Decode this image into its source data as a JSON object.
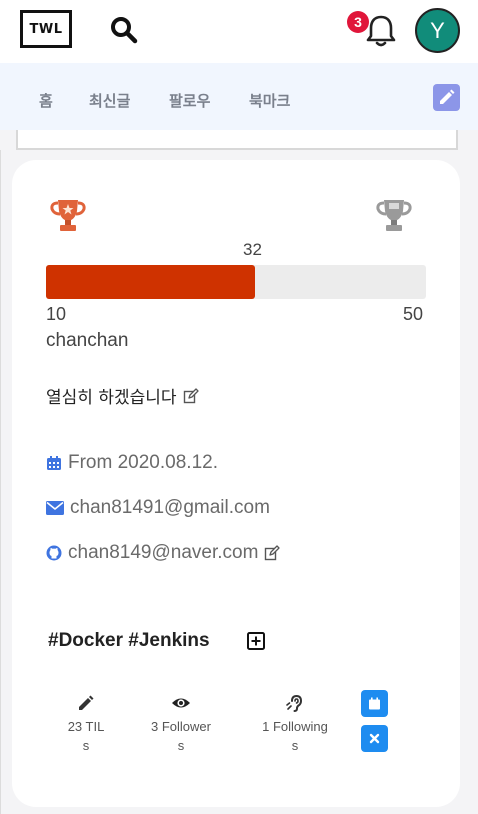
{
  "header": {
    "logo_text": "TWL",
    "notification_count": "3",
    "avatar_initial": "Y",
    "avatar_color": "#118c7a"
  },
  "nav": {
    "tabs": [
      {
        "label": "홈"
      },
      {
        "label": "최신글"
      },
      {
        "label": "팔로우"
      },
      {
        "label": "북마크"
      }
    ],
    "edit_icon": "pencil-icon"
  },
  "profile": {
    "trophy_left": "bronze-trophy-icon",
    "trophy_right": "silver-trophy-icon",
    "level_current": "32",
    "level_min": "10",
    "level_max": "50",
    "progress_fraction": 0.55,
    "progress_color": "#cf3200",
    "username": "chanchan",
    "bio": "열심히 하겠습니다",
    "joined": "From 2020.08.12.",
    "email": "chan81491@gmail.com",
    "github": "chan8149@naver.com",
    "tags": "#Docker #Jenkins"
  },
  "stats": {
    "tils_line1": "23 TIL",
    "tils_line2": "s",
    "followers_line1": "3 Follower",
    "followers_line2": "s",
    "followings_line1": "1 Following",
    "followings_line2": "s"
  },
  "colors": {
    "accent_blue": "#1e8cf0",
    "nav_edit": "#8c96e8",
    "badge_red": "#e0163a"
  }
}
